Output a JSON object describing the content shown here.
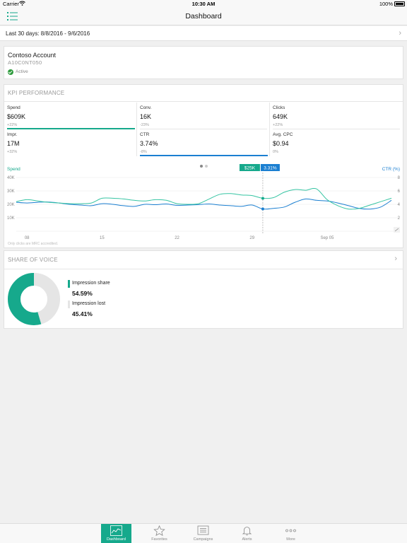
{
  "status_bar": {
    "carrier": "Carrier",
    "time": "10:30 AM",
    "battery": "100%"
  },
  "nav": {
    "title": "Dashboard"
  },
  "date_range": {
    "label": "Last 30 days: 8/8/2016 - 9/6/2016"
  },
  "account": {
    "name": "Contoso Account",
    "id": "A10C0NT050",
    "status": "Active"
  },
  "kpi": {
    "title": "KPI PERFORMANCE",
    "tiles": [
      {
        "label": "Spend",
        "value": "$609K",
        "change": "+22%",
        "bar": "teal"
      },
      {
        "label": "Conv.",
        "value": "16K",
        "change": "-23%",
        "bar": ""
      },
      {
        "label": "Clicks",
        "value": "649K",
        "change": "+22%",
        "bar": ""
      },
      {
        "label": "Impr.",
        "value": "17M",
        "change": "+32%",
        "bar": ""
      },
      {
        "label": "CTR",
        "value": "3.74%",
        "change": "-8%",
        "bar": "blue"
      },
      {
        "label": "Avg. CPC",
        "value": "$0.94",
        "change": "0%",
        "bar": ""
      }
    ],
    "footnote": "Only clicks are MRC accredited."
  },
  "colors": {
    "teal": "#16a98c",
    "teal_line": "#35c4a2",
    "blue": "#1b7fd1",
    "grey": "#e5e5e5"
  },
  "chart_data": {
    "type": "line",
    "left_axis_label": "Spend",
    "right_axis_label": "CTR (%)",
    "left_ticks": [
      "40K",
      "30K",
      "20K",
      "10K"
    ],
    "right_ticks": [
      "8",
      "6",
      "4",
      "2"
    ],
    "ylim_left": [
      0,
      40000
    ],
    "ylim_right": [
      0,
      8
    ],
    "x_ticks": [
      "08",
      "15",
      "22",
      "29",
      "Sep 05"
    ],
    "tooltip": {
      "spend": "$25K",
      "ctr": "3.31%"
    },
    "series": [
      {
        "name": "Spend",
        "axis": "left",
        "values": [
          22000,
          23500,
          22500,
          21500,
          21000,
          20500,
          20500,
          21000,
          24500,
          24500,
          24000,
          23000,
          22500,
          23500,
          23000,
          20500,
          20000,
          20500,
          24000,
          27500,
          28000,
          27000,
          26500,
          24500,
          25000,
          29000,
          31000,
          30500,
          31500,
          23500,
          19000,
          16500,
          17000,
          19500,
          22000,
          24500
        ]
      },
      {
        "name": "CTR (%)",
        "axis": "right",
        "values": [
          4.3,
          4.2,
          4.3,
          4.35,
          4.2,
          4.0,
          3.9,
          3.8,
          4.1,
          4.0,
          3.8,
          3.7,
          4.0,
          3.95,
          4.05,
          3.85,
          3.9,
          3.95,
          4.05,
          3.9,
          3.8,
          3.7,
          3.9,
          3.31,
          3.4,
          3.6,
          4.3,
          4.8,
          4.6,
          4.5,
          4.2,
          3.8,
          3.4,
          3.3,
          3.6,
          4.6
        ]
      }
    ]
  },
  "share_of_voice": {
    "title": "SHARE OF VOICE",
    "items": [
      {
        "label": "Impression share",
        "value": "54.59%",
        "share": 0.5459,
        "color": "#16a98c"
      },
      {
        "label": "Impression lost",
        "value": "45.41%",
        "share": 0.4541,
        "color": "#e5e5e5"
      }
    ]
  },
  "tabs": [
    {
      "label": "Dashboard",
      "icon": "dashboard-icon",
      "active": true
    },
    {
      "label": "Favorites",
      "icon": "star-icon",
      "active": false
    },
    {
      "label": "Campaigns",
      "icon": "campaigns-icon",
      "active": false
    },
    {
      "label": "Alerts",
      "icon": "bell-icon",
      "active": false
    },
    {
      "label": "More",
      "icon": "more-icon",
      "active": false
    }
  ]
}
